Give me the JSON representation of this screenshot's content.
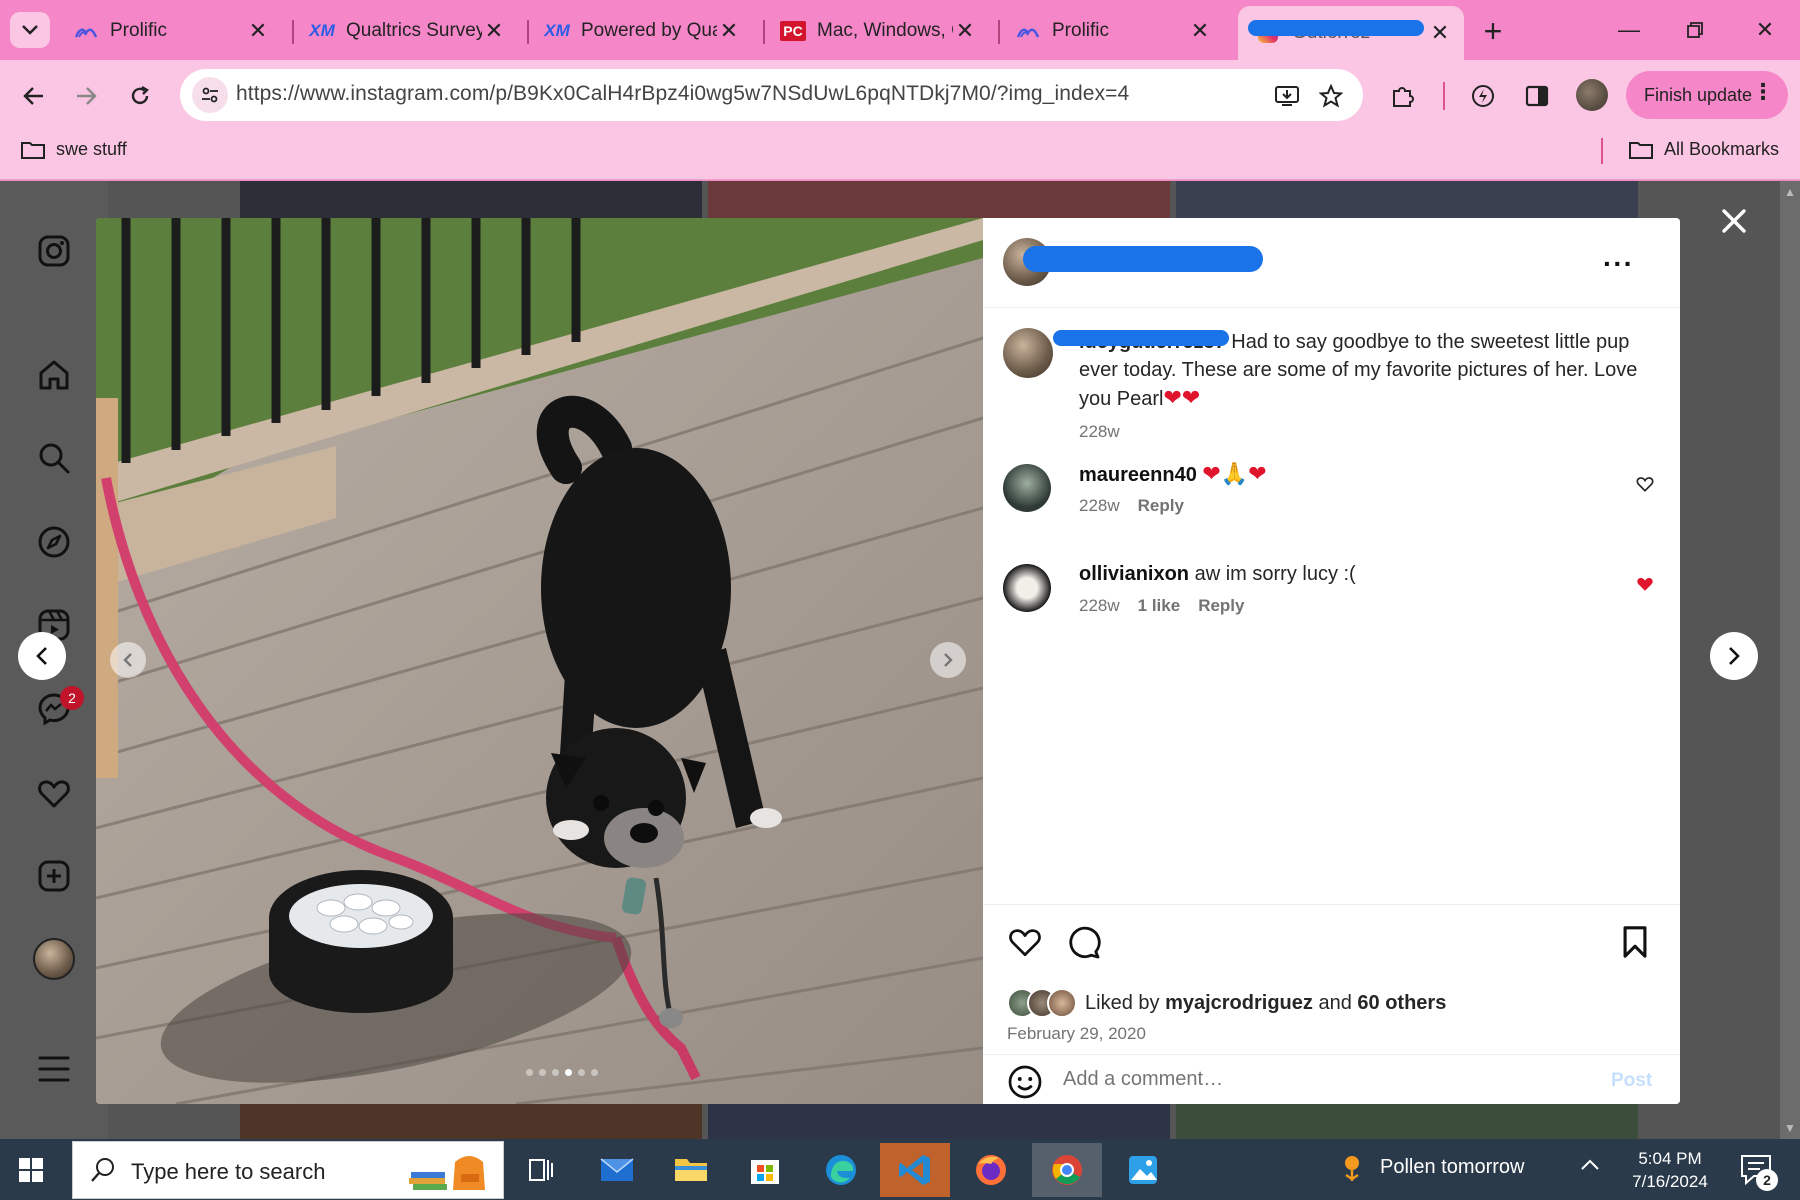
{
  "browser": {
    "tabs": [
      {
        "label": "Prolific",
        "icon": "prolific-icon"
      },
      {
        "label": "Qualtrics Survey",
        "icon": "qualtrics-icon"
      },
      {
        "label": "Powered by Qua",
        "icon": "qualtrics-icon"
      },
      {
        "label": "Mac, Windows, C",
        "icon": "pcmag-icon"
      },
      {
        "label": "Prolific",
        "icon": "prolific-icon"
      },
      {
        "label": "Gutierrez",
        "icon": "instagram-icon",
        "active": true
      }
    ],
    "url": "https://www.instagram.com/p/B9Kx0CalH4rBpz4i0wg5w7NSdUwL6pqNTDkj7M0/?img_index=4",
    "finish_update_label": "Finish update",
    "bookmarks": {
      "left_folder": "swe stuff",
      "right_folder": "All Bookmarks"
    }
  },
  "instagram": {
    "sidebar_badge": "2",
    "post": {
      "caption": {
        "username": "lucygutierrez87",
        "text": "Had to say goodbye to the sweetest little pup ever today. These are some of my favorite pictures of her. Love you Pearl",
        "emojis": "❤❤",
        "age": "228w"
      },
      "comments": [
        {
          "username": "maureenn40",
          "text": "❤🙏❤",
          "age": "228w",
          "likes": "",
          "reply_label": "Reply",
          "liked": false
        },
        {
          "username": "ollivianixon",
          "text": "aw im sorry lucy :(",
          "age": "228w",
          "likes": "1 like",
          "reply_label": "Reply",
          "liked": true
        }
      ],
      "liked_by_prefix": "Liked by",
      "liked_by_user": "myajcrodriguez",
      "liked_by_and": "and",
      "liked_by_others": "60 others",
      "date": "February 29, 2020",
      "comment_placeholder": "Add a comment…",
      "post_label": "Post"
    }
  },
  "taskbar": {
    "search_placeholder": "Type here to search",
    "weather": "Pollen tomorrow",
    "time": "5:04 PM",
    "date": "7/16/2024",
    "notification_count": "2"
  },
  "colors": {
    "chrome_frame": "#f587c8",
    "chrome_toolbar": "#fbc6e3",
    "ig_like_red": "#e0142c",
    "redaction_blue": "#1a73e8",
    "taskbar": "#2b3a4a"
  }
}
